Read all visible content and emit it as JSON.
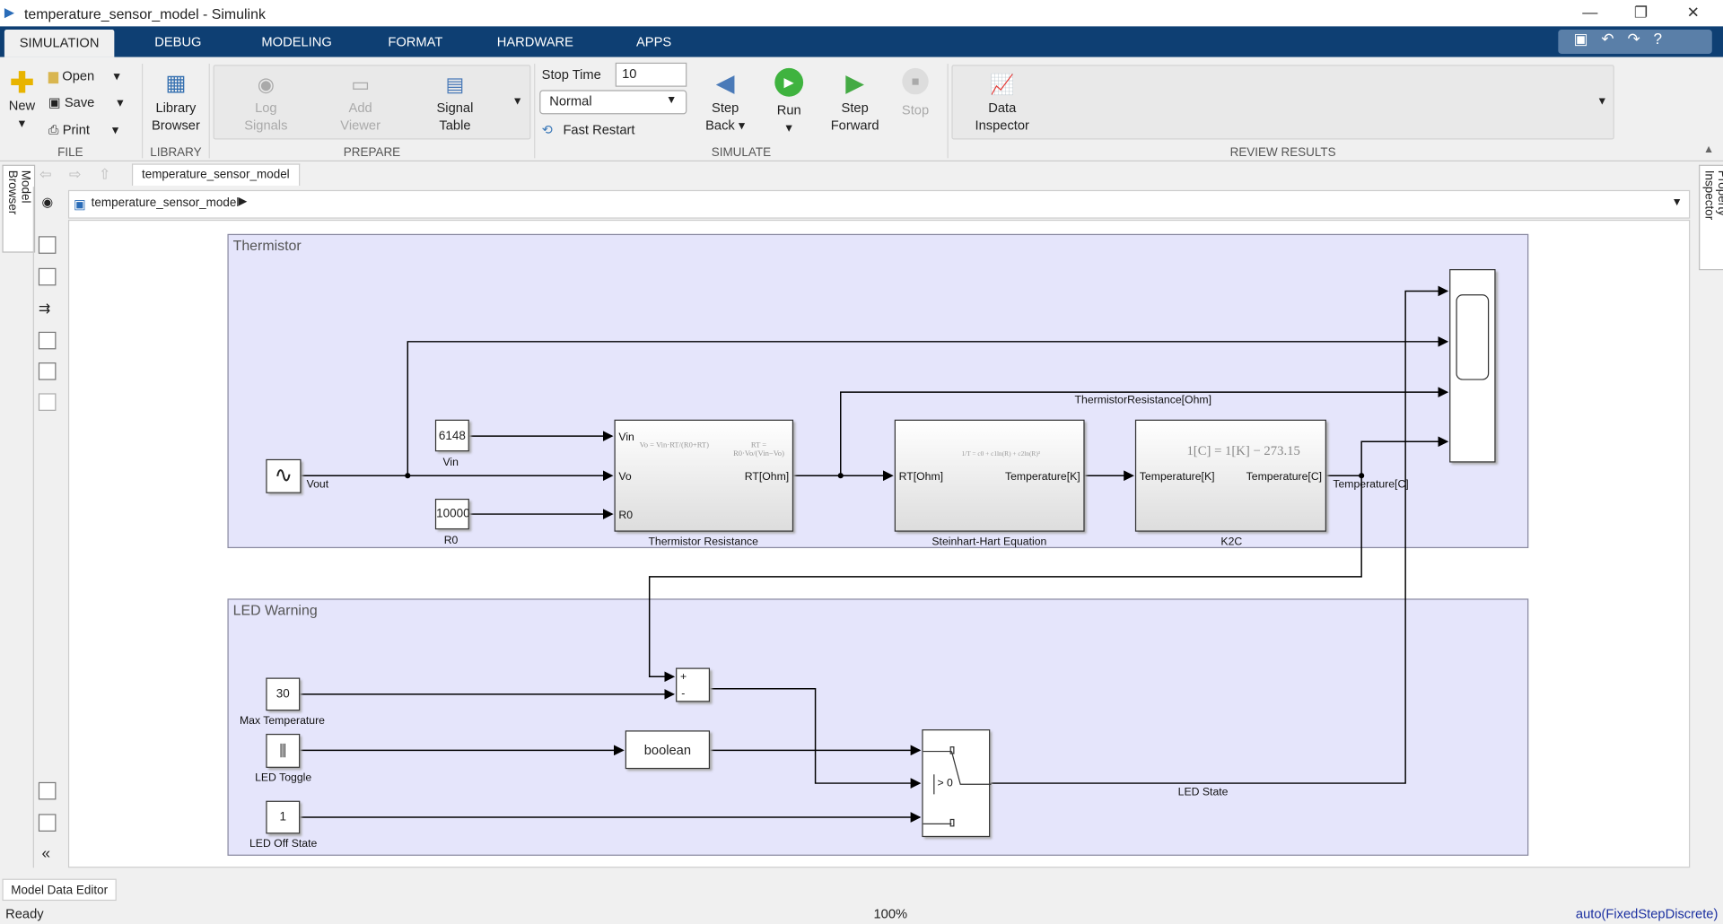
{
  "window": {
    "title": "temperature_sensor_model - Simulink"
  },
  "tabs": [
    {
      "label": "SIMULATION",
      "active": true
    },
    {
      "label": "DEBUG"
    },
    {
      "label": "MODELING"
    },
    {
      "label": "FORMAT"
    },
    {
      "label": "HARDWARE"
    },
    {
      "label": "APPS"
    }
  ],
  "ribbon": {
    "file": {
      "title": "FILE",
      "new": "New",
      "open": "Open",
      "save": "Save",
      "print": "Print"
    },
    "library": {
      "title": "LIBRARY",
      "browser_line1": "Library",
      "browser_line2": "Browser"
    },
    "prepare": {
      "title": "PREPARE",
      "log1": "Log",
      "log2": "Signals",
      "add1": "Add",
      "add2": "Viewer",
      "sig1": "Signal",
      "sig2": "Table"
    },
    "simulate": {
      "title": "SIMULATE",
      "stop_time_label": "Stop Time",
      "stop_time_value": "10",
      "mode": "Normal",
      "fast_restart": "Fast Restart",
      "step_back1": "Step",
      "step_back2": "Back",
      "run": "Run",
      "step_fwd1": "Step",
      "step_fwd2": "Forward",
      "stop": "Stop"
    },
    "review": {
      "title": "REVIEW RESULTS",
      "di1": "Data",
      "di2": "Inspector"
    }
  },
  "editor": {
    "tab": "temperature_sensor_model",
    "breadcrumb": "temperature_sensor_model",
    "left_tab": "Model Browser",
    "right_tab": "Property Inspector"
  },
  "diagram": {
    "thermistor_area": "Thermistor",
    "led_area": "LED Warning",
    "vout": "Vout",
    "vin_value": "6148",
    "vin_label": "Vin",
    "r0_value": "10000",
    "r0_label": "R0",
    "thermistor_block": {
      "name": "Thermistor Resistance",
      "in1": "Vin",
      "in2": "Vo",
      "in3": "R0",
      "out": "RT[Ohm]",
      "eq1": "Vo = Vin·RT/(R0+RT)",
      "eq2": "RT = R0·Vo/(Vin−Vo)"
    },
    "sh_block": {
      "name": "Steinhart-Hart Equation",
      "in": "RT[Ohm]",
      "out": "Temperature[K]",
      "eq": "1/T = c0 + c1ln(R) + c2ln(R)³"
    },
    "k2c_block": {
      "name": "K2C",
      "in": "Temperature[K]",
      "out": "Temperature[C]",
      "eq": "1[C] = 1[K] − 273.15"
    },
    "signal_resistance": "ThermistorResistance[Ohm]",
    "signal_temp": "Temperature[C]",
    "max_temp_value": "30",
    "max_temp_label": "Max Temperature",
    "led_toggle_label": "LED Toggle",
    "boolean": "boolean",
    "off_value": "1",
    "off_label": "LED Off State",
    "sum_plus": "+",
    "sum_minus": "-",
    "switch_cond": "> 0",
    "led_state": "LED State"
  },
  "bottom": {
    "tab": "Model Data Editor",
    "status": "Ready",
    "zoom": "100%",
    "solver": "auto(FixedStepDiscrete)"
  }
}
